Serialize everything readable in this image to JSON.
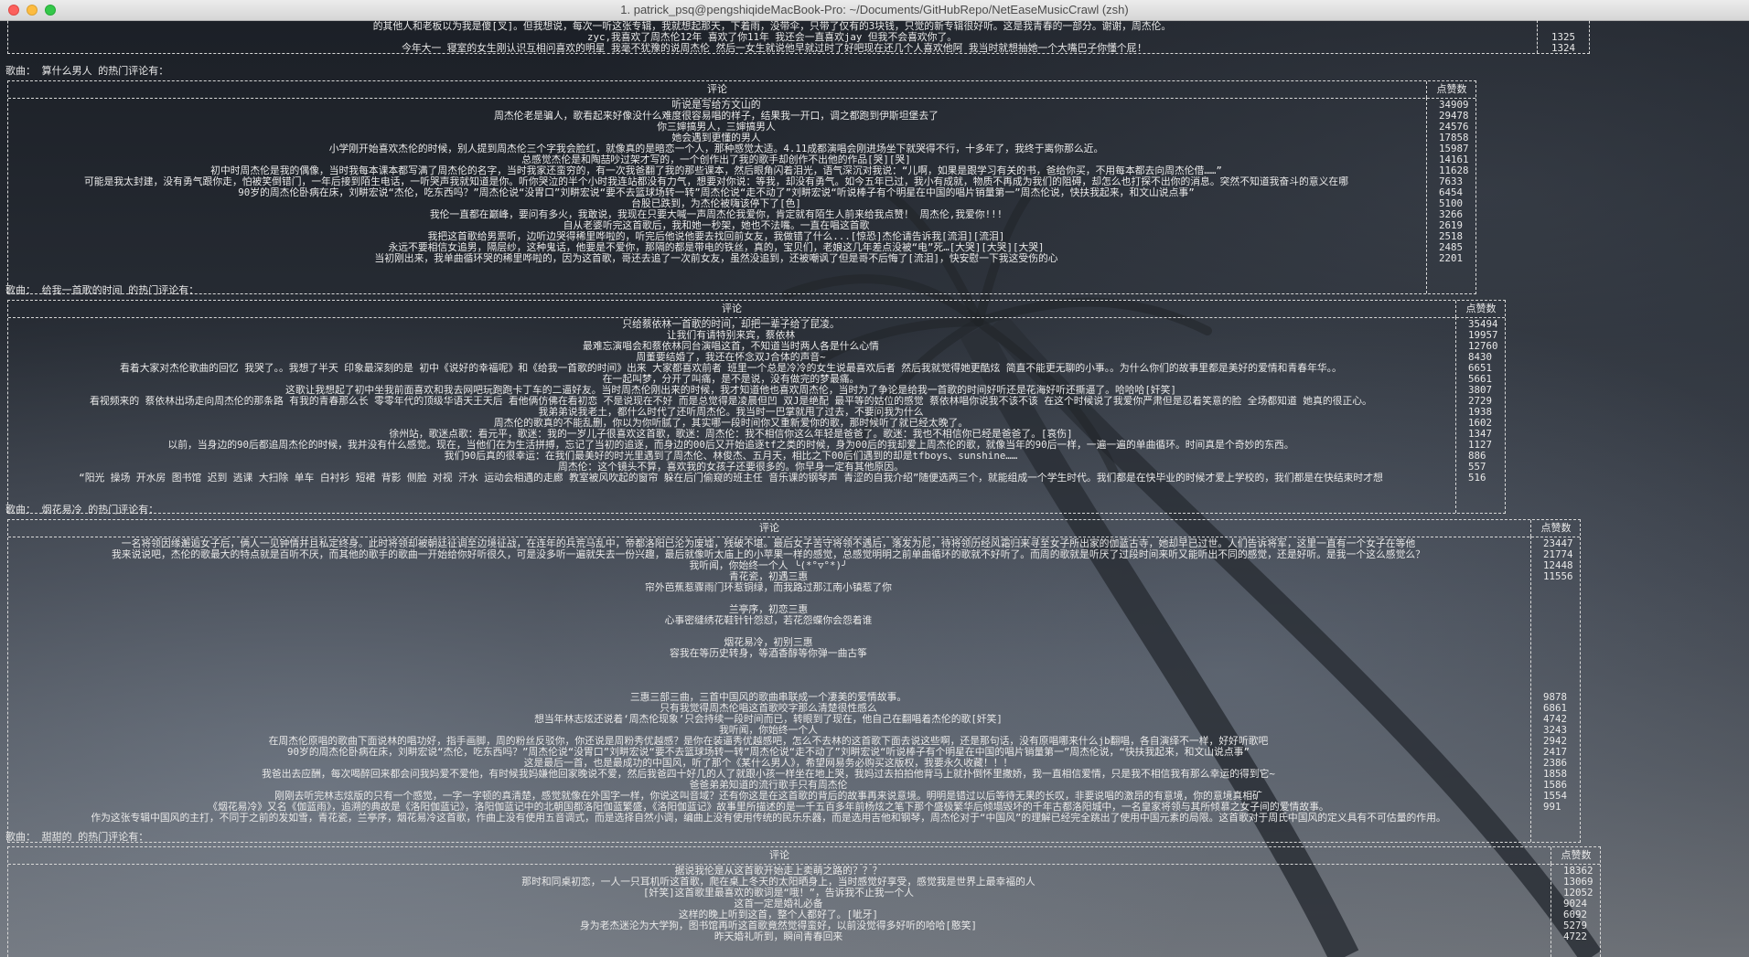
{
  "window": {
    "title": "1. patrick_psq@pengshiqideMacBook-Pro: ~/Documents/GitHubRepo/NetEaseMusicCrawl (zsh)"
  },
  "top_fragment": {
    "lines": [
      "的其他人和老板以为我是傻[叉]。但我想说，每次一听这张专辑，我就想起那天，下着雨，没带伞，只带了仅有的3块钱，只觉的新专辑很好听。这是我青春的一部分。谢谢，周杰伦。",
      "zyc,我喜欢了周杰伦12年 喜欢了你11年 我还会一直喜欢jay 但我不会喜欢你了。",
      "今年大一 寝室的女生刚认识互相问喜欢的明星 我毫不犹豫的说周杰伦 然后一女生就说他早就过时了好吧现在还几个人喜欢他阿 我当时就想抽她一个大嘴巴子你懂个屁!"
    ],
    "likes": [
      "",
      "1325",
      "1324"
    ]
  },
  "sections": [
    {
      "label": "歌曲： 算什么男人 的热门评论有：",
      "header_comment": "评论",
      "header_likes": "点赞数",
      "comments": [
        "听说是写给方文山的",
        "周杰伦老是骗人，歌看起来好像没什么难度很容易唱的样子，结果我一开口，调之都跑到伊斯坦堡去了",
        "你三婶搞男人，三婶搞男人",
        "她会遇到更懂的男人",
        "小学刚开始喜欢杰伦的时候，别人提到周杰伦三个字我会脸红，就像真的是暗恋一个人，那种感觉太适。4.11成都演唱会刚进场坐下就哭得不行，十多年了，我终于离你那么近。",
        "总感觉杰伦是和陶喆吵过架才写的，一个创作出了我的歌手却创作不出他的作品[哭][哭]",
        "初中时周杰伦是我的偶像，当时我每本课本都写满了周杰伦的名字，当时我家还蛮穷的，有一次我爸翻了我的那些课本，然后眼角闪着泪光，语气深沉对我说：“儿啊，如果是跟学习有关的书，爸给你买，不用每本都去向周杰伦借……”",
        "可能是我太封建，没有勇气跟你走，怕被笑倒错门，一年后接到陌生电话，一听哭声我就知道是你。听你哭泣的半个小时我连站都没有力气，想要对你说：等我，却没有勇气。如今五年已过，我小有成就，物质不再成为我们的阻碍，却怎么也打探不出你的消息。突然不知道我奋斗的意义在哪",
        "90岁的周杰伦卧病在床，刘畊宏说“杰伦，吃东西吗？”周杰伦说“没胃口”刘畊宏说“要不去篮球场转一转”周杰伦说“走不动了”刘畊宏说“听说棒子有个明星在中国的唱片销量第一”周杰伦说，快扶我起来，和文山说点事”",
        "台股已跌到，为杰伦被嗨该停下了[色]",
        "我伦一直都在巅峰，要问有多火，我敢说，我现在只要大喊一声周杰伦我爱你，肯定就有陌生人前来给我点赞！ 周杰伦,我爱你!!!",
        "自从老婆听完这首歌后，我和她一秒架，她也不法嘴。一直在唱这首歌",
        "我把这首歌给男票听，边听边哭得稀里哗啦的，听完后他说他要去找回前女友，我做错了什么...[惊恐]杰伦请告诉我[流泪][流泪]",
        "永远不要相信女追男，隔层纱，这种鬼话，他要是不爱你，那隔的都是带电的铁丝，真的，宝贝们，老娘这几年差点没被“电”死…[大哭][大哭][大哭]",
        "当初刚出来，我单曲循环哭的稀里哗啦的，因为这首歌，哥还去追了一次前女友，虽然没追到，还被嘲讽了但是哥不后悔了[流泪]，快安慰一下我这受伤的心"
      ],
      "likes": [
        "34909",
        "29478",
        "24576",
        "17858",
        "15987",
        "14161",
        "11628",
        "7633",
        "6454",
        "5100",
        "3266",
        "2619",
        "2518",
        "2485",
        "2201"
      ]
    },
    {
      "label": "歌曲： 给我一首歌的时间 的热门评论有：",
      "header_comment": "评论",
      "header_likes": "点赞数",
      "comments": [
        "只给蔡依林一首歌的时间，却把一辈子给了昆凌。",
        "让我们有请特别来宾，蔡依林",
        "最难忘演唱会和蔡依林同台演唱这首，不知道当时两人各是什么心情",
        "周董要结婚了，我还在怀念双J合体的声音~",
        "看着大家对杰伦歌曲的回忆 我哭了。。我想了半天 印象最深刻的是 初中《说好的幸福呢》和《给我一首歌的时间》出来 大家都喜欢前者 班里一个总是冷冷的女生说最喜欢后者 然后我就觉得她更酷炫 简直不能更无聊的小事。。为什么你们的故事里都是美好的爱情和青春年华。。",
        "在一起叫梦，分开了叫痛，是不是说，没有做完的梦最痛。",
        "这歌让我想起了初中坐我前面喜欢和我去网吧玩跑跑卡丁车的二逼好友。当时周杰伦刚出来的时候，我才知道他也喜欢周杰伦，当时为了争论是给我一首歌的时间好听还是花海好听还撕逼了。哈哈哈[奸笑]",
        "看视频来的 蔡依林出场走向周杰伦的那条路 有我的青春那么长 零零年代的顶级华语天王天后 看他俩仿佛在看初恋 不是说现在不好 而是总觉得是凌晨但凹 双J是绝配 最平等的姑位的感觉 蔡依林唱你说我不该不该 在这个时候说了我爱你严肃但是忍着笑意的脸 全场都知道 她真的很正心。",
        "我弟弟说我老土，都什么时代了还听周杰伦。我当时一巴掌就甩了过去，不要问我为什么",
        "周杰伦的歌真的不能乱删，你以为你听腻了，其实哪一段时间你又重新爱你的歌，那时候听了就已经太晚了。",
        "徐州站，歌迷点歌：看元平，歌迷：我的一岁儿子很喜欢这首歌，歌迷：周杰伦：我不相信你这么年轻是爸爸了。歌迷：我也不相信你已经是爸爸了。[哀伤]",
        "以前，当身边的90后都追周杰伦的时候，我并没有什么感觉。现在，当他们在为生活拼搏，忘记了当初的追逐，而身边的00后又开始追逐tf之类的时候，身为00后的我却爱上周杰伦的歌，就像当年的90后一样，一遍一遍的单曲循环。时间真是个奇妙的东西。",
        "我们90后真的很幸运：在我们最美好的时光里遇到了周杰伦、林俊杰、五月天，相比之下00后们遇到的却是tfboys、sunshine……",
        "周杰伦：这个镜头不算，喜欢我的女孩子还要很多的。你早身一定有其他原因。",
        "“阳光 操场 开水房 图书馆 迟到 逃课 大扫除 单车 白衬衫 短裙 背影 侧脸 对视 汗水 运动会相遇的走廊 教室被风吹起的窗帘 躲在后门偷窥的班主任 音乐课的钢琴声 青涩的自我介绍”随便选两三个，就能组成一个学生时代。我们都是在快毕业的时候才爱上学校的，我们都是在快结束时才想"
      ],
      "likes": [
        "35494",
        "19957",
        "12760",
        "8430",
        "6651",
        "5661",
        "3807",
        "2729",
        "1938",
        "1602",
        "1347",
        "1127",
        "886",
        "557",
        "516"
      ]
    },
    {
      "label": "歌曲： 烟花易冷 的热门评论有：",
      "header_comment": "评论",
      "header_likes": "点赞数",
      "comments": [
        "一名将领因缘邂逅女子后，俩人一见钟情并且私定终身。此时将领却被朝廷征调至边境征战，在连年的兵荒马乱中，帝都洛阳已沦为废墟，残破不堪。最后女子苦守将领不遇后，落发为尼，待将领历经风霜归来寻至女子所出家的伽蓝古寺，她却早已过世。人们告诉将军，这里一直有一个女子在等他",
        "我来说说吧，杰伦的歌最大的特点就是百听不厌，而其他的歌手的歌曲一开始给你好听很久，可是没多听一遍就失去一份兴趣，最后就像听太庙上的小苹果一样的感觉，总感觉明明之前单曲循环的歌就不好听了。而周的歌就是听厌了过段时间来听又能听出不同的感觉，还是好听。是我一个这么感觉么？",
        "我听闻，你始终一个人 ╰(*°▽°*)╯",
        "青花瓷，初遇三惠",
        "帘外芭蕉惹骤雨门环惹铜绿，而我路过那江南小镇惹了你",
        "",
        "兰亭序，初恋三惠",
        "心事密缝绣花鞋针针怨怼，若花怨蝶你会怨着谁",
        "",
        "烟花易冷，初别三惠",
        "容我在等历史转身，等酒香醇等你弹一曲古筝",
        "",
        "",
        "",
        "三惠三部三曲，三首中国风的歌曲串联成一个凄美的爱情故事。",
        "只有我觉得周杰伦唱这首歌咬字那么清楚很性感么",
        "想当年林志炫还说着‘周杰伦现象’只会持续一段时间而已，转眼到了现在，他自己在翻唱着杰伦的歌[奸笑]",
        "我听闻，你始终一个人",
        "在周杰伦原唱的歌曲下面说林的唱功好，指手画脚，周的粉丝反驳你，你还说是周粉秀优越感？是你在装逼秀优越感吧，怎么不去林的这首歌下面去说这些啊，还是那句话，没有原唱哪来什么jb翻唱，各自演绎不一样，好好听歌吧",
        "90岁的周杰伦卧病在床，刘畊宏说“杰伦，吃东西吗？”周杰伦说“没胃口”刘畊宏说“要不去篮球场转一转”周杰伦说“走不动了”刘畊宏说“听说棒子有个明星在中国的唱片销量第一”周杰伦说，“快扶我起来，和文山说点事”",
        "这是最后一首，也是最成功的中国风，听了那个《某什么男人》，希望网易务必购买这版权，我要永久收藏！！！",
        "我爸出去应酬，每次喝醉回来都会问我妈爱不爱他，有时候我妈嫌他回家晚说不爱，然后我爸四十好几的人了就跟小孩一样坐在地上哭，我妈过去拍拍他背马上就扑倒怀里撒娇，我一直相信爱情，只是我不相信我有那么幸运的得到它~",
        "爸爸弟弟知道的流行歌手只有周杰伦",
        "刚刚去听完林志炫版的只有一个感觉，一字一字顿的真清楚，感觉就像在外国字一样，你说这叫音域？还有你这是在这首歌的背后的故事再来说意境。明明是错过以后等待无果的长叹，非要说唱的激昂的有意境，你的意境真相矿",
        "《烟花易冷》又名《伽蓝雨》，追溯的典故是《洛阳伽蓝记》，洛阳伽蓝记中的北朝国都洛阳伽蓝繁盛，《洛阳伽蓝记》故事里所描述的是一千五百多年前杨炫之笔下那个盛极繁华后倾塌毁坏的千年古都洛阳城中，一名皇家将领与其所倾慕之女子间的爱情故事。",
        "作为这张专辑中国风的主打，不同于之前的发如雪，青花瓷，兰亭序，烟花易冷这首歌，作曲上没有使用五音调式，而是选择自然小调，编曲上没有使用传统的民乐乐器，而是选用吉他和钢琴，周杰伦对于“中国风”的理解已经完全跳出了使用中国元素的局限。这首歌对于周氏中国风的定义具有不可估量的作用。"
      ],
      "likes": [
        "23447",
        "21774",
        "12448",
        "11556",
        "",
        "",
        "",
        "",
        "",
        "",
        "",
        "",
        "",
        "",
        "9878",
        "6861",
        "4742",
        "3243",
        "2942",
        "2417",
        "2386",
        "1858",
        "1586",
        "1554",
        "991"
      ]
    },
    {
      "label": "歌曲： 甜甜的 的热门评论有：",
      "header_comment": "评论",
      "header_likes": "点赞数",
      "comments": [
        "据说我伦是从这首歌开始走上卖萌之路的？？？",
        "那时和同桌初恋，一人一只耳机听这首歌，爬在桌上冬天的太阳晒身上，当时感觉好享受，感觉我是世界上最幸福的人",
        "[奸笑]这首歌里最喜欢的歌词是“哦！”，告诉我不止我一个人",
        "这首一定是婚礼必备",
        "这样的晚上听到这首，整个人都好了。[呲牙]",
        "身为老杰迷沦为大学狗，图书馆再听这首歌竟然觉得蛮好，以前没觉得多好听的哈哈[憨笑]",
        "昨天婚礼听到，瞬间青春回来"
      ],
      "likes": [
        "18362",
        "13069",
        "12052",
        "9024",
        "6092",
        "5279",
        "4722"
      ]
    }
  ]
}
